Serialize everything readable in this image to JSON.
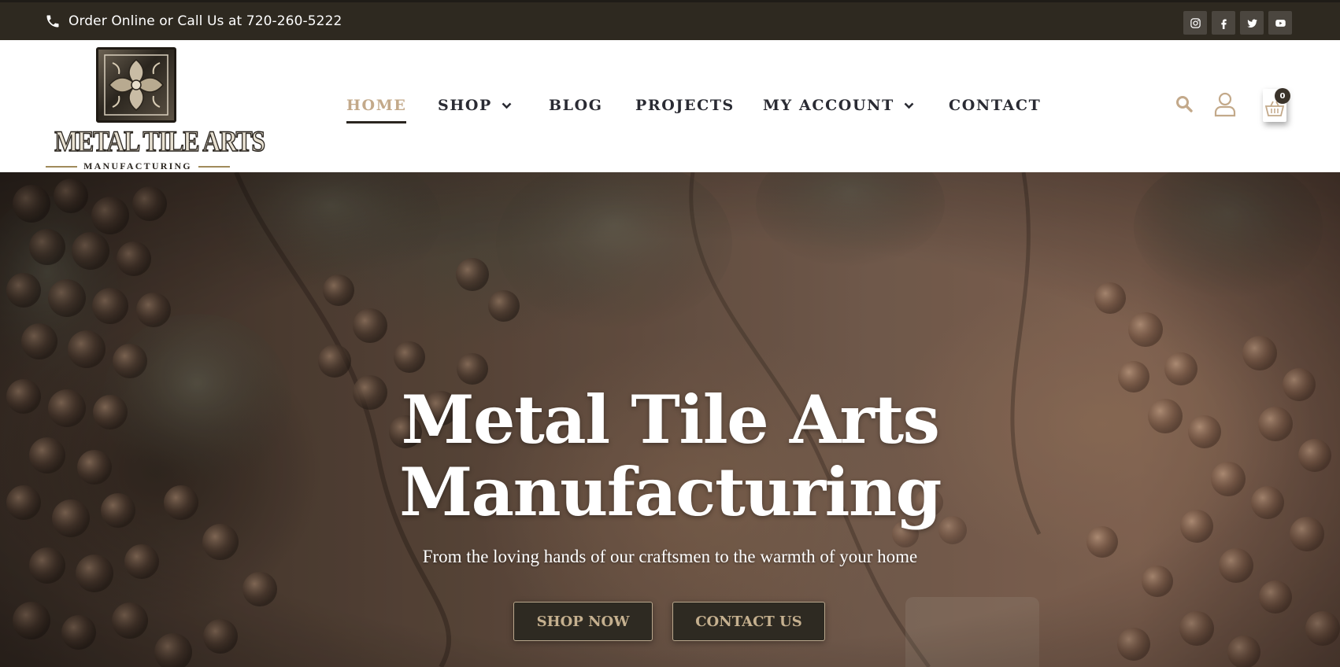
{
  "topbar": {
    "phone_text": "Order Online or Call Us at 720-260-5222",
    "social": [
      {
        "icon": "instagram-icon"
      },
      {
        "icon": "facebook-icon"
      },
      {
        "icon": "twitter-icon"
      },
      {
        "icon": "youtube-icon"
      }
    ]
  },
  "header": {
    "logo": {
      "title": "METAL TILE ARTS",
      "subtitle": "MANUFACTURING"
    },
    "nav": [
      {
        "label": "HOME",
        "active": true
      },
      {
        "label": "SHOP",
        "has_dropdown": true
      },
      {
        "label": "BLOG"
      },
      {
        "label": "PROJECTS"
      },
      {
        "label": "MY ACCOUNT",
        "has_dropdown": true
      },
      {
        "label": "CONTACT"
      }
    ],
    "icons": [
      "search-icon",
      "user-icon",
      "cart-icon"
    ],
    "cart_count": "0"
  },
  "hero": {
    "title_line1": "Metal Tile Arts",
    "title_line2": "Manufacturing",
    "subtitle": "From the loving hands of our craftsmen to the warmth of your home",
    "buttons": [
      {
        "label": "SHOP NOW"
      },
      {
        "label": "CONTACT US"
      }
    ]
  },
  "colors": {
    "topbar_bg": "#2e2920",
    "accent_gold": "#c3a98a",
    "nav_text": "#2a2b33",
    "button_bg": "#2e2a22"
  }
}
